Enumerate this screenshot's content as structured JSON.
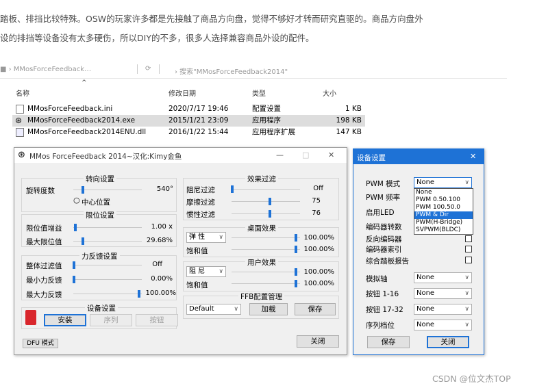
{
  "article": {
    "line1": "踏板、排挡比较特殊。OSW的玩家许多都是先接触了商品方向盘，觉得不够好才转而研究直驱的。商品方向盘外",
    "line2": "设的排挡等设备没有太多硬伤，所以DIY的不多，很多人选择兼容商品外设的配件。"
  },
  "explorer": {
    "path_left": "■ › MMosForceFeedback…",
    "path_right": "› 搜索\"MMosForceFeedback2014\"",
    "headers": {
      "name": "名称",
      "date": "修改日期",
      "type": "类型",
      "size": "大小"
    },
    "files": [
      {
        "name": "MMosForceFeedback.ini",
        "date": "2020/7/17 19:46",
        "type": "配置设置",
        "size": "1 KB",
        "icon": "ini-file-icon"
      },
      {
        "name": "MMosForceFeedback2014.exe",
        "date": "2015/1/21 23:09",
        "type": "应用程序",
        "size": "198 KB",
        "icon": "steering-wheel-icon",
        "selected": true
      },
      {
        "name": "MMosForceFeedback2014ENU.dll",
        "date": "2016/1/22 15:44",
        "type": "应用程序扩展",
        "size": "147 KB",
        "icon": "dll-file-icon"
      }
    ]
  },
  "mainwin": {
    "title": "MMos ForceFeedback 2014~汉化:Kimy金鱼",
    "controls": {
      "min": "—",
      "max": "□",
      "close": "✕"
    },
    "steering": {
      "title": "转向设置",
      "rotation_label": "旋转度数",
      "rotation_value": "540°",
      "rotation_pct": 0.12,
      "center_label": "中心位置"
    },
    "limit": {
      "title": "限位设置",
      "gain_label": "限位值增益",
      "gain_value": "1.00 x",
      "gain_pct": 0.05,
      "max_label": "最大限位值",
      "max_value": "29.68%",
      "max_pct": 0.12
    },
    "force": {
      "title": "力反馈设置",
      "filter_label": "整体过滤值",
      "filter_value": "Off",
      "filter_pct": 0.0,
      "min_label": "最小力反馈",
      "min_value": "0.00%",
      "min_pct": 0.0,
      "max_label": "最大力反馈",
      "max_value": "100.00%",
      "max_pct": 1.0
    },
    "device": {
      "title": "设备设置",
      "install": "安装",
      "serial": "序列",
      "button": "按钮"
    },
    "dfu": "DFU 模式",
    "effect": {
      "title": "效果过滤",
      "damper_label": "阻尼过滤",
      "damper_value": "Off",
      "damper_pct": 0.0,
      "friction_label": "摩擦过滤",
      "friction_value": "75",
      "friction_pct": 0.5,
      "inertia_label": "惯性过滤",
      "inertia_value": "76",
      "inertia_pct": 0.5
    },
    "desktop": {
      "title": "桌面效果",
      "select": "弹 性",
      "val1": "100.00%",
      "saturation_label": "饱和值",
      "val2": "100.00%"
    },
    "user": {
      "title": "用户效果",
      "select": "阻 尼",
      "val1": "100.00%",
      "saturation_label": "饱和值",
      "val2": "100.00%"
    },
    "ffb": {
      "title": "FFB配置管理",
      "select": "Default",
      "load": "加载",
      "save": "保存"
    },
    "close": "关闭"
  },
  "devwin": {
    "title": "设备设置",
    "close_x": "✕",
    "pwm_mode_label": "PWM 模式",
    "pwm_mode_value": "None",
    "pwm_options": [
      "None",
      "PWM 0.50.100",
      "PWM 100.50.0",
      "PWM & Dir",
      "PWM(H-Bridge)",
      "SVPWM(BLDC)"
    ],
    "pwm_highlight": 3,
    "pwm_freq_label": "PWM 频率",
    "enable_led_label": "启用LED",
    "encoder_cpr_label": "编码器转数",
    "reverse_encoder_label": "反向编码器",
    "encoder_index_label": "编码器索引",
    "pedal_report_label": "综合踏板报告",
    "analog_label": "模拟轴",
    "btn_1_16_label": "按钮 1-16",
    "btn_17_32_label": "按钮 17-32",
    "serial_shift_label": "序列档位",
    "none": "None",
    "save": "保存",
    "close": "关闭"
  },
  "watermark": "CSDN @位文杰TOP",
  "colors": {
    "accent": "#1e72d6"
  }
}
